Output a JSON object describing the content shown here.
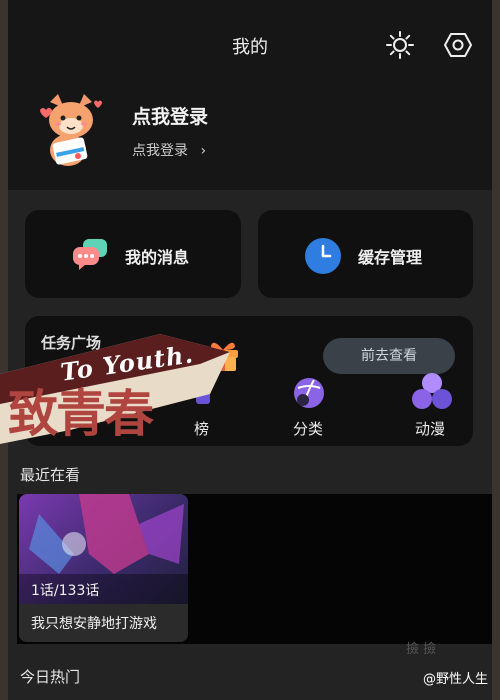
{
  "header": {
    "title": "我的",
    "sun_icon": "brightness-icon",
    "settings_icon": "hex-settings-icon"
  },
  "profile": {
    "login_title": "点我登录",
    "login_sub": "点我登录",
    "chevron": "›"
  },
  "quick_actions": [
    {
      "label": "我的消息",
      "icon": "chat-bubbles-icon"
    },
    {
      "label": "缓存管理",
      "icon": "clock-icon"
    }
  ],
  "tasks": {
    "title": "任务广场",
    "pill": "前去查看"
  },
  "categories": [
    {
      "label": "榜"
    },
    {
      "label": "分类"
    },
    {
      "label": "动漫"
    }
  ],
  "recent": {
    "label": "最近在看",
    "item": {
      "episode": "1话/133话",
      "title": "我只想安静地打游戏"
    }
  },
  "today": {
    "label": "今日热门"
  },
  "overlay": {
    "to_youth": "To Youth.",
    "cn": "致青春"
  },
  "watermark": {
    "text": "@野性人生",
    "faint": "撿  撿"
  },
  "colors": {
    "background": "#141414",
    "card": "#101010",
    "accent_blue": "#2f7de0",
    "banner_red": "#b0453f",
    "purple": "#8a63e6"
  }
}
